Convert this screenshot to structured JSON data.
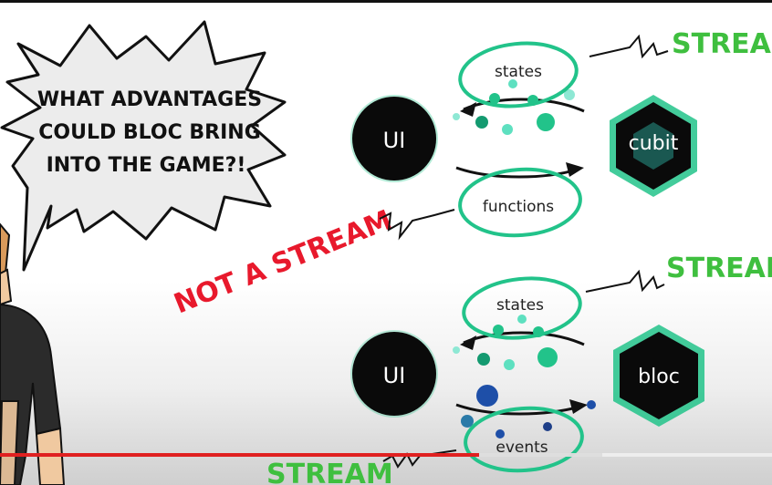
{
  "speech_bubble": {
    "lines": [
      "WHAT ADVANTAGES",
      "COULD BLOC BRING",
      "INTO THE GAME?!"
    ]
  },
  "cubit_diagram": {
    "ui_label": "UI",
    "node_label": "cubit",
    "top_label": "states",
    "bottom_label": "functions",
    "top_stream_label": "STREAM"
  },
  "bloc_diagram": {
    "ui_label": "UI",
    "node_label": "bloc",
    "top_label": "states",
    "bottom_label": "events",
    "top_stream_label": "STREAM",
    "bottom_stream_label": "STREAM"
  },
  "not_a_stream_label": "NOT A STREAM",
  "colors": {
    "accent_green": "#22c38a",
    "stream_green": "#3fbf3f",
    "not_stream_red": "#e8192c",
    "node_black": "#0a0a0a",
    "dot_blue": "#1e4fa8",
    "progress_red": "#e02020"
  },
  "player": {
    "progress_fraction": 0.62
  }
}
